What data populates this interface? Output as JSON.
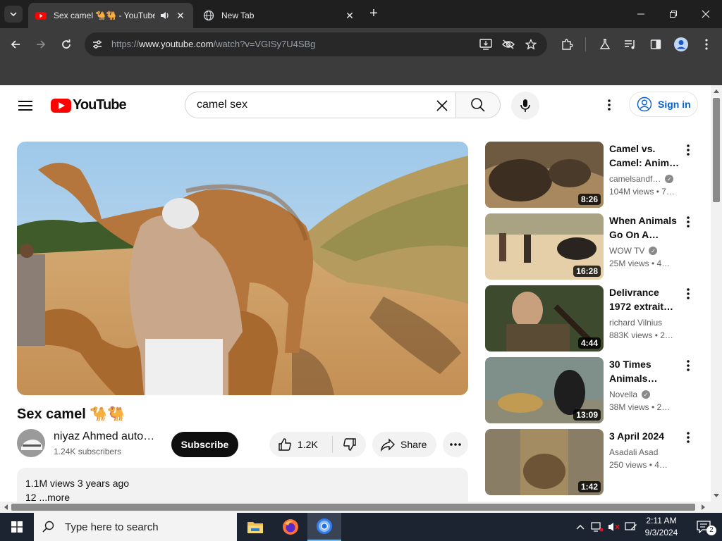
{
  "browser": {
    "tabs": [
      {
        "title": "Sex camel 🐪🐫 - YouTube",
        "active": true
      },
      {
        "title": "New Tab",
        "active": false
      }
    ],
    "address_prefix": "https://",
    "address_domain": "www.youtube.com",
    "address_path": "/watch?v=VGISy7U4SBg"
  },
  "youtube": {
    "logo_text": "YouTube",
    "search_query": "camel sex",
    "sign_in_label": "Sign in",
    "video": {
      "title": "Sex camel 🐪🐫",
      "channel_name": "niyaz Ahmed auto…",
      "subscribers": "1.24K subscribers",
      "subscribe_label": "Subscribe",
      "likes": "1.2K",
      "share_label": "Share",
      "views_date": "1.1M views  3 years ago",
      "description_snippet": "12 ...more"
    },
    "recommendations": [
      {
        "title_line1": "Camel vs.",
        "title_line2": "Camel: Anima…",
        "channel": "camelsandf…",
        "verified": true,
        "stats": "104M views  • 7…",
        "duration": "8:26"
      },
      {
        "title_line1": "When Animals",
        "title_line2": "Go On A…",
        "channel": "WOW TV",
        "verified": true,
        "stats": "25M views  • 4…",
        "duration": "16:28"
      },
      {
        "title_line1": "Delivrance",
        "title_line2": "1972 extrait…",
        "channel": "richard Vilnius",
        "verified": false,
        "stats": "883K views  • 2…",
        "duration": "4:44"
      },
      {
        "title_line1": "30 Times",
        "title_line2": "Animals…",
        "channel": "Novella",
        "verified": true,
        "stats": "38M views  • 2…",
        "duration": "13:09"
      },
      {
        "title_line1": "3 April 2024",
        "title_line2": "",
        "channel": "Asadali Asad",
        "verified": false,
        "stats": "250 views  • 4…",
        "duration": "1:42"
      }
    ]
  },
  "taskbar": {
    "search_placeholder": "Type here to search",
    "time": "2:11 AM",
    "date": "9/3/2024",
    "notification_count": "2"
  }
}
